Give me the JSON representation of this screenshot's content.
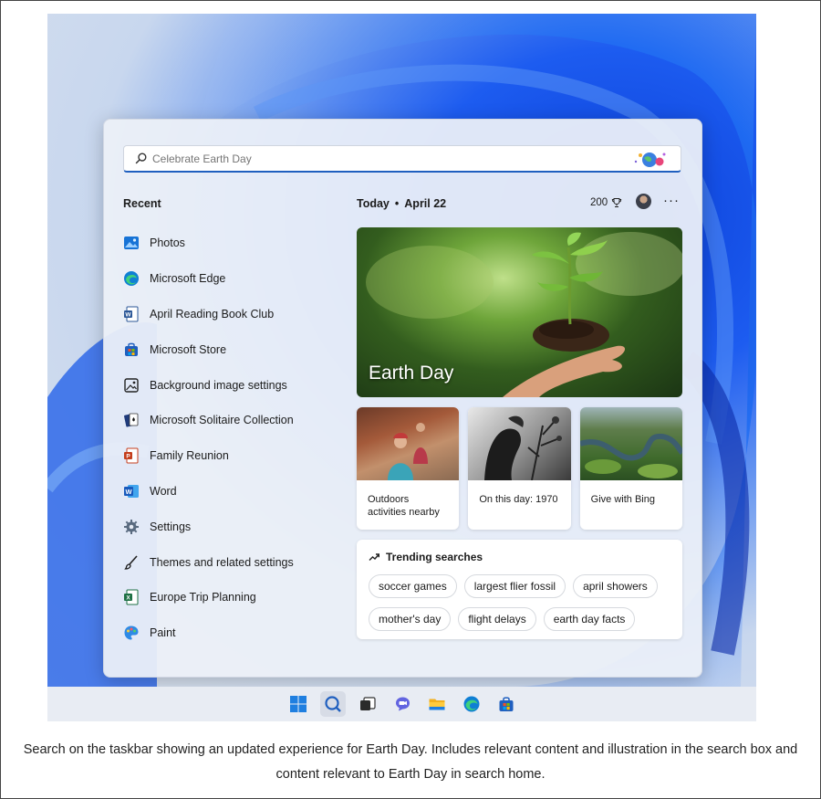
{
  "search": {
    "placeholder": "Celebrate Earth Day"
  },
  "recent": {
    "title": "Recent",
    "items": [
      {
        "label": "Photos",
        "icon": "photos-icon"
      },
      {
        "label": "Microsoft Edge",
        "icon": "edge-icon"
      },
      {
        "label": "April Reading Book Club",
        "icon": "word-document-icon"
      },
      {
        "label": "Microsoft Store",
        "icon": "store-icon"
      },
      {
        "label": "Background image settings",
        "icon": "image-settings-icon"
      },
      {
        "label": "Microsoft Solitaire Collection",
        "icon": "solitaire-icon"
      },
      {
        "label": "Family Reunion",
        "icon": "powerpoint-icon"
      },
      {
        "label": "Word",
        "icon": "word-icon"
      },
      {
        "label": "Settings",
        "icon": "gear-icon"
      },
      {
        "label": "Themes and related settings",
        "icon": "brush-icon"
      },
      {
        "label": "Europe Trip Planning",
        "icon": "excel-icon"
      },
      {
        "label": "Paint",
        "icon": "paint-icon"
      }
    ]
  },
  "today": {
    "label": "Today",
    "date": "April 22",
    "points": "200",
    "more": "···"
  },
  "hero": {
    "title": "Earth Day"
  },
  "cards": [
    {
      "label": "Outdoors activities nearby"
    },
    {
      "label": "On this day: 1970"
    },
    {
      "label": "Give with Bing"
    }
  ],
  "trending": {
    "title": "Trending searches",
    "chips": [
      "soccer games",
      "largest flier fossil",
      "april showers",
      "mother's day",
      "flight delays",
      "earth day facts"
    ]
  },
  "taskbar": {
    "icons": [
      "windows-start-icon",
      "search-icon",
      "task-view-icon",
      "chat-icon",
      "file-explorer-icon",
      "edge-icon",
      "store-icon"
    ]
  },
  "caption": {
    "text": "Search on the taskbar showing an updated experience for Earth Day. Includes relevant content and illustration in the search box and content relevant to Earth Day in search home."
  }
}
